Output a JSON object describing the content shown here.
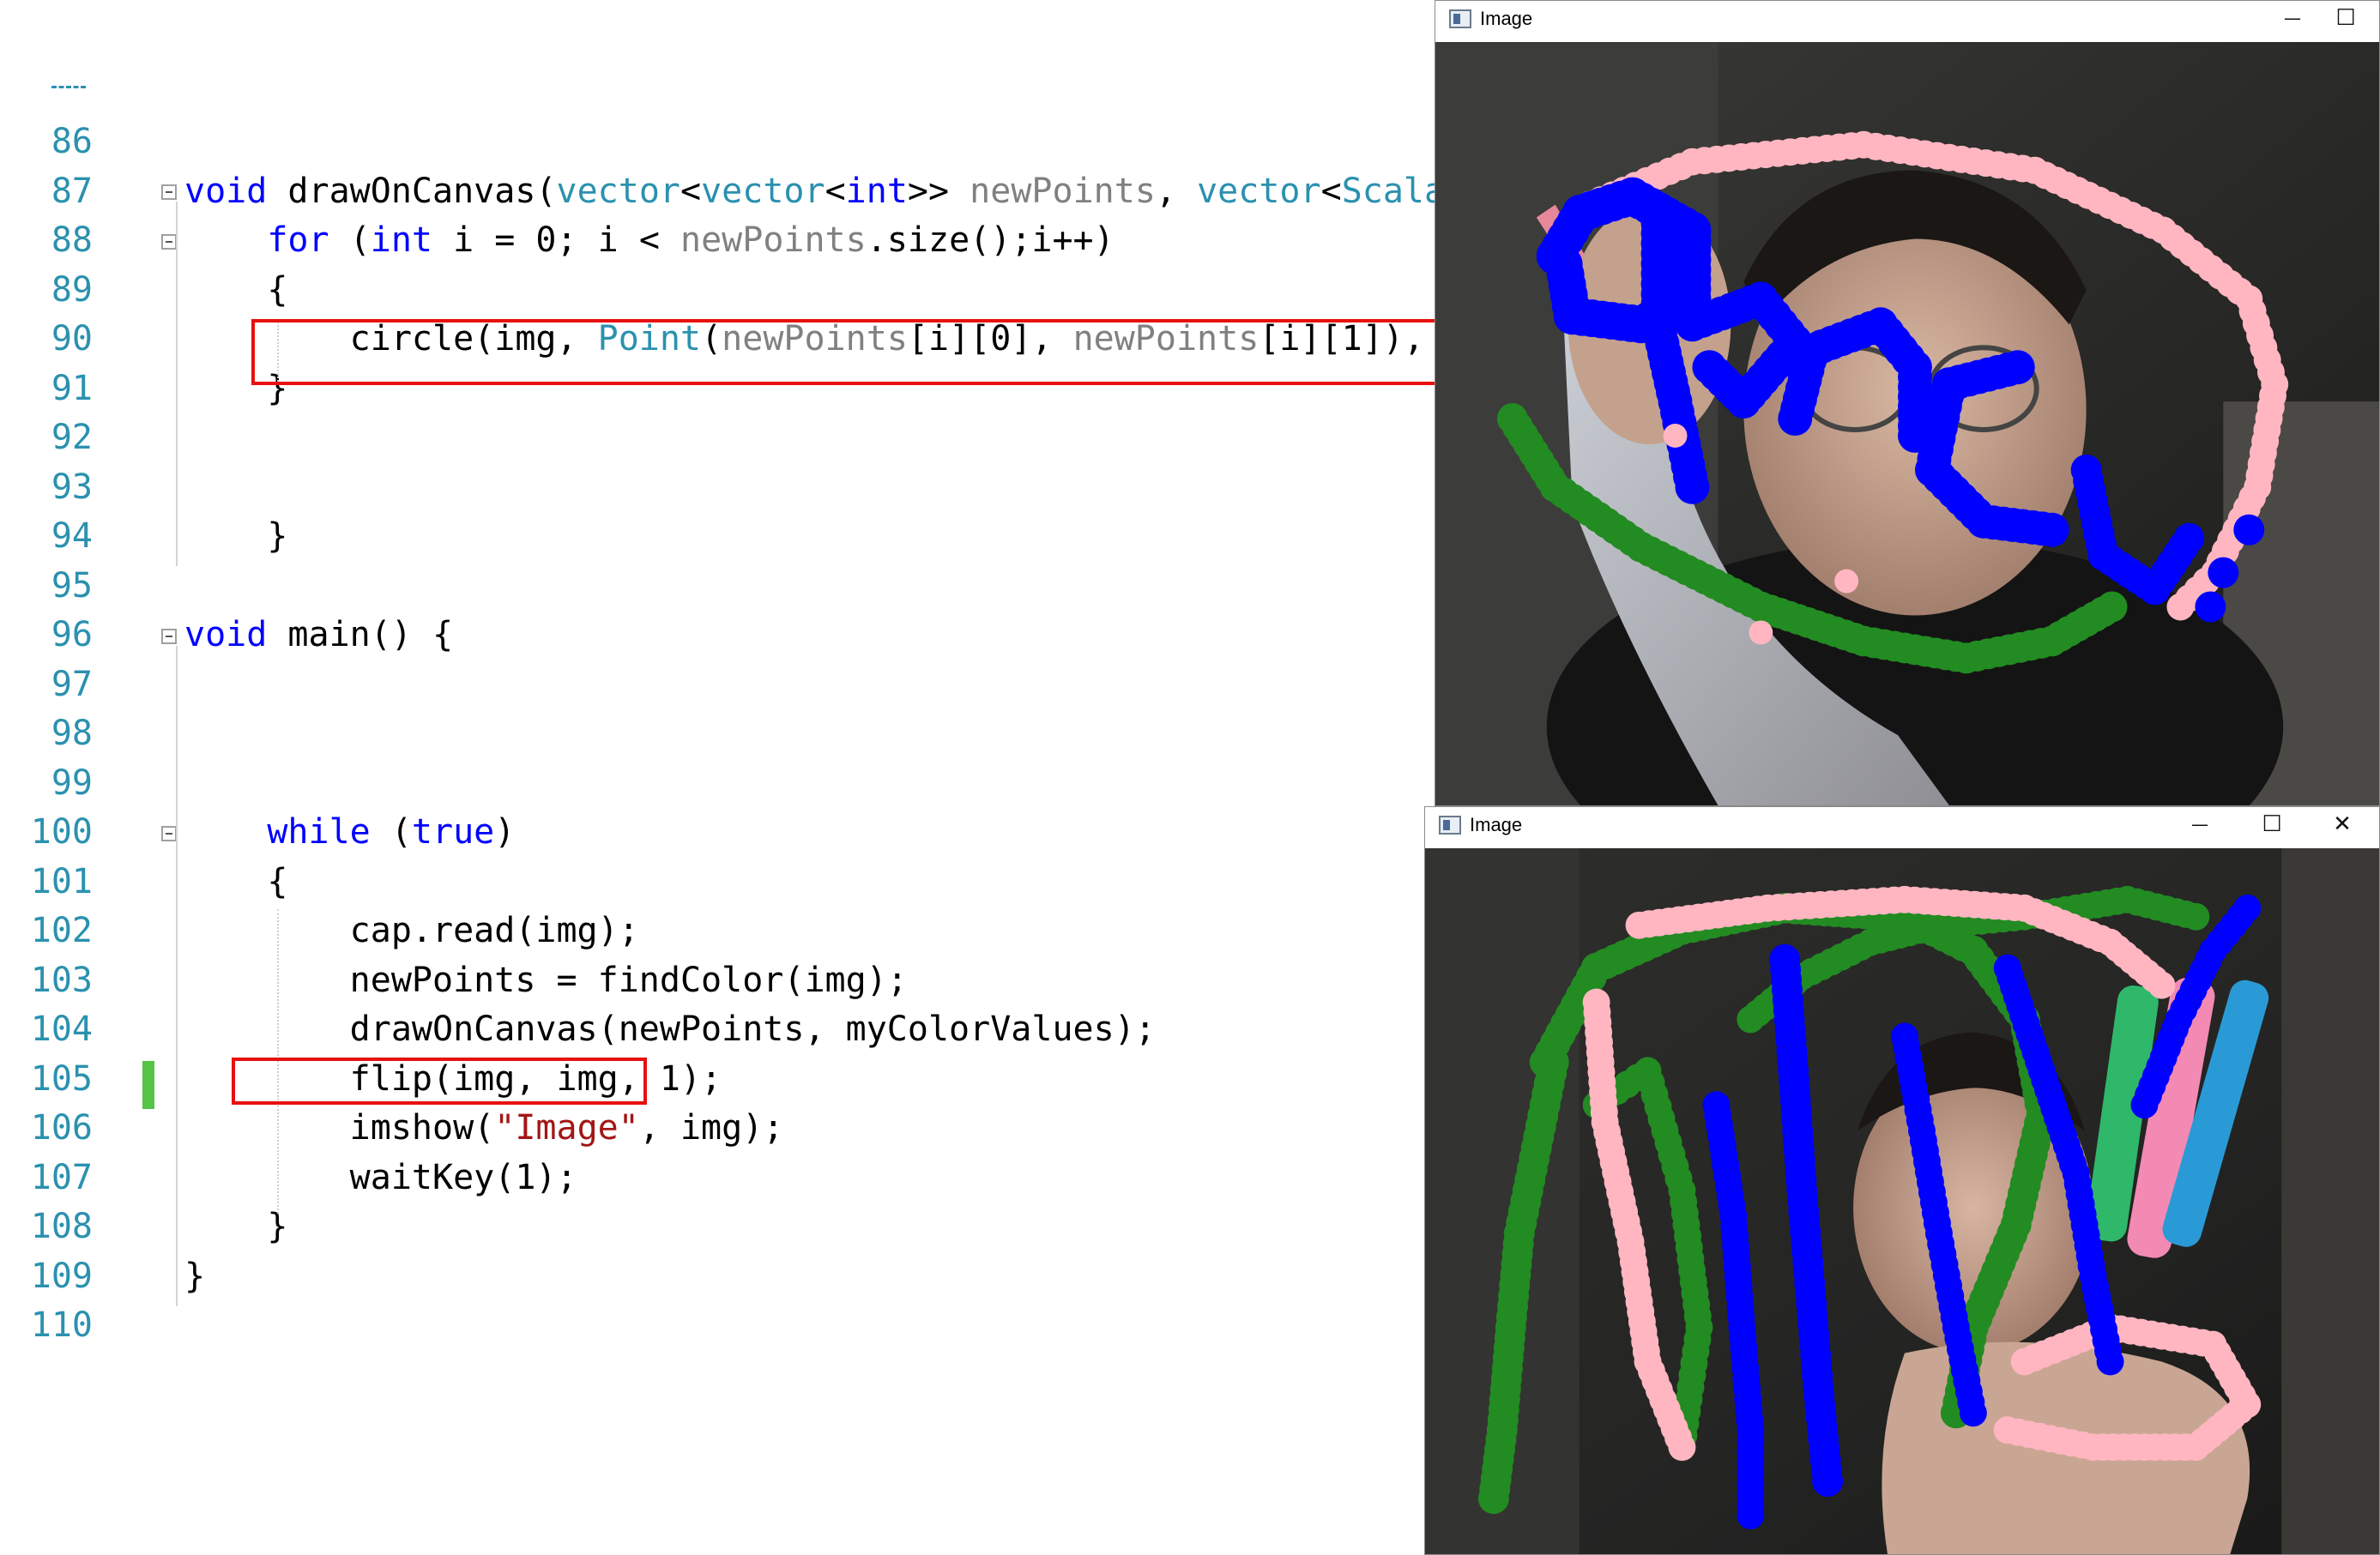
{
  "editor": {
    "lines": [
      {
        "n": "86",
        "tokens": []
      },
      {
        "n": "87",
        "tokens": [
          [
            "kw",
            "void"
          ],
          [
            "tx",
            " drawOnCanvas("
          ],
          [
            "ty",
            "vector"
          ],
          [
            "tx",
            "<"
          ],
          [
            "ty",
            "vector"
          ],
          [
            "tx",
            "<"
          ],
          [
            "kw",
            "int"
          ],
          [
            "tx",
            ">> "
          ],
          [
            "pa",
            "newPoints"
          ],
          [
            "tx",
            ", "
          ],
          [
            "ty",
            "vector"
          ],
          [
            "tx",
            "<"
          ],
          [
            "ty",
            "Scalar"
          ]
        ]
      },
      {
        "n": "88",
        "tokens": [
          [
            "tx",
            "    "
          ],
          [
            "kw",
            "for"
          ],
          [
            "tx",
            " ("
          ],
          [
            "kw",
            "int"
          ],
          [
            "tx",
            " i = 0; i < "
          ],
          [
            "pa",
            "newPoints"
          ],
          [
            "tx",
            ".size();i++)"
          ]
        ]
      },
      {
        "n": "89",
        "tokens": [
          [
            "tx",
            "    {"
          ]
        ]
      },
      {
        "n": "90",
        "tokens": [
          [
            "tx",
            "        circle(img, "
          ],
          [
            "ty",
            "Point"
          ],
          [
            "tx",
            "("
          ],
          [
            "pa",
            "newPoints"
          ],
          [
            "tx",
            "[i][0], "
          ],
          [
            "pa",
            "newPoints"
          ],
          [
            "tx",
            "[i][1]), "
          ]
        ]
      },
      {
        "n": "91",
        "tokens": [
          [
            "tx",
            "    }"
          ]
        ]
      },
      {
        "n": "92",
        "tokens": []
      },
      {
        "n": "93",
        "tokens": []
      },
      {
        "n": "94",
        "tokens": [
          [
            "tx",
            "    }"
          ]
        ]
      },
      {
        "n": "95",
        "tokens": []
      },
      {
        "n": "96",
        "tokens": [
          [
            "kw",
            "void"
          ],
          [
            "tx",
            " main() {"
          ]
        ]
      },
      {
        "n": "97",
        "tokens": []
      },
      {
        "n": "98",
        "tokens": []
      },
      {
        "n": "99",
        "tokens": []
      },
      {
        "n": "100",
        "tokens": [
          [
            "tx",
            "    "
          ],
          [
            "kw",
            "while"
          ],
          [
            "tx",
            " ("
          ],
          [
            "kw",
            "true"
          ],
          [
            "tx",
            ")"
          ]
        ]
      },
      {
        "n": "101",
        "tokens": [
          [
            "tx",
            "    {"
          ]
        ]
      },
      {
        "n": "102",
        "tokens": [
          [
            "tx",
            "        cap.read(img);"
          ]
        ]
      },
      {
        "n": "103",
        "tokens": [
          [
            "tx",
            "        newPoints = findColor(img);"
          ]
        ]
      },
      {
        "n": "104",
        "tokens": [
          [
            "tx",
            "        drawOnCanvas(newPoints, myColorValues);"
          ]
        ]
      },
      {
        "n": "105",
        "tokens": [
          [
            "tx",
            "        flip(img, img, 1);"
          ]
        ]
      },
      {
        "n": "106",
        "tokens": [
          [
            "tx",
            "        imshow("
          ],
          [
            "st",
            "\"Image\""
          ],
          [
            "tx",
            ", img);"
          ]
        ]
      },
      {
        "n": "107",
        "tokens": [
          [
            "tx",
            "        waitKey(1);"
          ]
        ]
      },
      {
        "n": "108",
        "tokens": [
          [
            "tx",
            "    }"
          ]
        ]
      },
      {
        "n": "109",
        "tokens": [
          [
            "tx",
            "}"
          ]
        ]
      },
      {
        "n": "110",
        "tokens": []
      }
    ]
  },
  "window_top": {
    "title": "Image",
    "minimize": "—",
    "maximize": "☐"
  },
  "window_bottom": {
    "title": "Image",
    "minimize": "—",
    "maximize": "☐",
    "close": "✕"
  },
  "colors": {
    "keyword": "#0000ff",
    "type": "#2b91af",
    "param": "#808080",
    "string": "#a31515",
    "highlight_box": "#e81010",
    "change_bar": "#56c447",
    "stroke_blue": "#0000ff",
    "stroke_green": "#228b22",
    "stroke_pink": "#ffb6c1"
  }
}
